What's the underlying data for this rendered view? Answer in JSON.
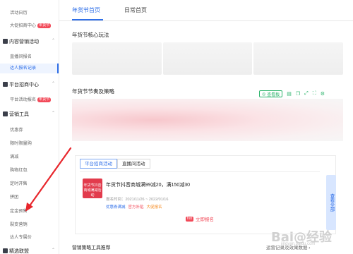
{
  "sidebar": {
    "items": [
      {
        "label": "活动日历"
      },
      {
        "label": "大促招商中心",
        "badge": "年货节"
      },
      {
        "group": "内容营销活动"
      },
      {
        "label": "直播间报名"
      },
      {
        "label": "达人报名记录",
        "active": true
      },
      {
        "group": "平台招商中心"
      },
      {
        "label": "平台活动报名",
        "badge": "年货节"
      },
      {
        "group": "营销工具"
      },
      {
        "label": "优惠券"
      },
      {
        "label": "限时限量购"
      },
      {
        "label": "满减"
      },
      {
        "label": "购物红包"
      },
      {
        "label": "定时开售"
      },
      {
        "label": "拼团"
      },
      {
        "label": "定金预售"
      },
      {
        "label": "裂变营销"
      },
      {
        "label": "达人专属价"
      },
      {
        "group": "精选联盟"
      }
    ]
  },
  "tabs": [
    {
      "label": "年货节首页",
      "active": true
    },
    {
      "label": "日常首页"
    }
  ],
  "sections": {
    "core": "年货节核心玩法",
    "rhythm": "年货节节奏及策略"
  },
  "tools": {
    "view_label": "查看板",
    "icons": [
      "doc-icon",
      "copy-icon",
      "expand-icon",
      "fullscreen-icon",
      "settings-icon"
    ]
  },
  "activity_tabs": [
    {
      "label": "平台招商活动",
      "active": true
    },
    {
      "label": "直播间活动"
    }
  ],
  "activity": {
    "thumb_text": "年货节抖音商城满减活动",
    "title": "年货节抖音商城满99减20，满150减30",
    "time": "报名时间：2021/11/26 ~ 2022/01/16",
    "tags": [
      {
        "label": "优惠券满减",
        "color": "#2f6fe8"
      },
      {
        "label": "官方补贴",
        "color": "#f24a59"
      },
      {
        "label": "大促报名",
        "color": "#f58a1f"
      }
    ],
    "signup_badge": "hot",
    "signup_label": "立即报名"
  },
  "view_all": "查看全部",
  "bottom": {
    "title": "营销策略工具推荐",
    "link": "运营记录及效果数据 ›"
  },
  "watermark": {
    "brand": "Bai@经验",
    "sub": "jingyan.baidu.com"
  },
  "colors": {
    "accent": "#2f6fe8",
    "hot": "#f24a59",
    "tool_green": "#2bb36b"
  }
}
